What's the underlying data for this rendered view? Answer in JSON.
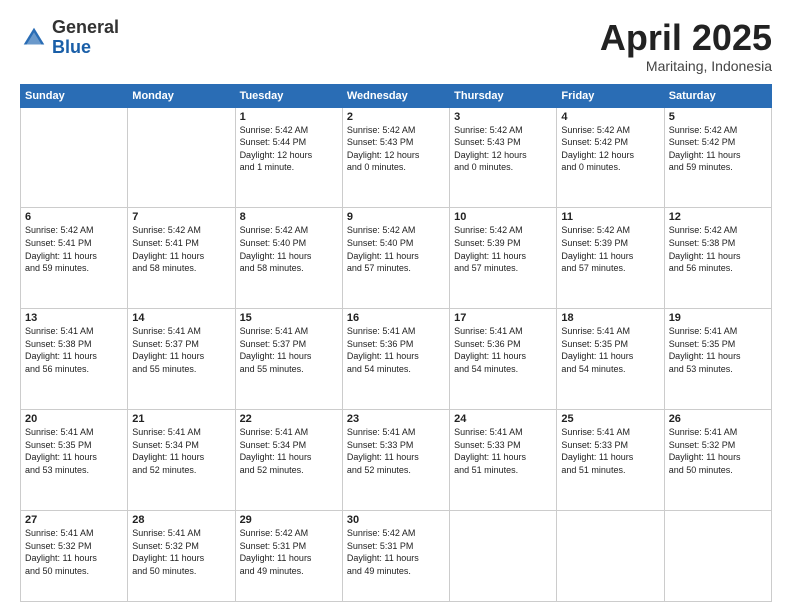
{
  "header": {
    "logo_general": "General",
    "logo_blue": "Blue",
    "month_title": "April 2025",
    "location": "Maritaing, Indonesia"
  },
  "weekdays": [
    "Sunday",
    "Monday",
    "Tuesday",
    "Wednesday",
    "Thursday",
    "Friday",
    "Saturday"
  ],
  "weeks": [
    [
      {
        "day": "",
        "info": ""
      },
      {
        "day": "",
        "info": ""
      },
      {
        "day": "1",
        "info": "Sunrise: 5:42 AM\nSunset: 5:44 PM\nDaylight: 12 hours\nand 1 minute."
      },
      {
        "day": "2",
        "info": "Sunrise: 5:42 AM\nSunset: 5:43 PM\nDaylight: 12 hours\nand 0 minutes."
      },
      {
        "day": "3",
        "info": "Sunrise: 5:42 AM\nSunset: 5:43 PM\nDaylight: 12 hours\nand 0 minutes."
      },
      {
        "day": "4",
        "info": "Sunrise: 5:42 AM\nSunset: 5:42 PM\nDaylight: 12 hours\nand 0 minutes."
      },
      {
        "day": "5",
        "info": "Sunrise: 5:42 AM\nSunset: 5:42 PM\nDaylight: 11 hours\nand 59 minutes."
      }
    ],
    [
      {
        "day": "6",
        "info": "Sunrise: 5:42 AM\nSunset: 5:41 PM\nDaylight: 11 hours\nand 59 minutes."
      },
      {
        "day": "7",
        "info": "Sunrise: 5:42 AM\nSunset: 5:41 PM\nDaylight: 11 hours\nand 58 minutes."
      },
      {
        "day": "8",
        "info": "Sunrise: 5:42 AM\nSunset: 5:40 PM\nDaylight: 11 hours\nand 58 minutes."
      },
      {
        "day": "9",
        "info": "Sunrise: 5:42 AM\nSunset: 5:40 PM\nDaylight: 11 hours\nand 57 minutes."
      },
      {
        "day": "10",
        "info": "Sunrise: 5:42 AM\nSunset: 5:39 PM\nDaylight: 11 hours\nand 57 minutes."
      },
      {
        "day": "11",
        "info": "Sunrise: 5:42 AM\nSunset: 5:39 PM\nDaylight: 11 hours\nand 57 minutes."
      },
      {
        "day": "12",
        "info": "Sunrise: 5:42 AM\nSunset: 5:38 PM\nDaylight: 11 hours\nand 56 minutes."
      }
    ],
    [
      {
        "day": "13",
        "info": "Sunrise: 5:41 AM\nSunset: 5:38 PM\nDaylight: 11 hours\nand 56 minutes."
      },
      {
        "day": "14",
        "info": "Sunrise: 5:41 AM\nSunset: 5:37 PM\nDaylight: 11 hours\nand 55 minutes."
      },
      {
        "day": "15",
        "info": "Sunrise: 5:41 AM\nSunset: 5:37 PM\nDaylight: 11 hours\nand 55 minutes."
      },
      {
        "day": "16",
        "info": "Sunrise: 5:41 AM\nSunset: 5:36 PM\nDaylight: 11 hours\nand 54 minutes."
      },
      {
        "day": "17",
        "info": "Sunrise: 5:41 AM\nSunset: 5:36 PM\nDaylight: 11 hours\nand 54 minutes."
      },
      {
        "day": "18",
        "info": "Sunrise: 5:41 AM\nSunset: 5:35 PM\nDaylight: 11 hours\nand 54 minutes."
      },
      {
        "day": "19",
        "info": "Sunrise: 5:41 AM\nSunset: 5:35 PM\nDaylight: 11 hours\nand 53 minutes."
      }
    ],
    [
      {
        "day": "20",
        "info": "Sunrise: 5:41 AM\nSunset: 5:35 PM\nDaylight: 11 hours\nand 53 minutes."
      },
      {
        "day": "21",
        "info": "Sunrise: 5:41 AM\nSunset: 5:34 PM\nDaylight: 11 hours\nand 52 minutes."
      },
      {
        "day": "22",
        "info": "Sunrise: 5:41 AM\nSunset: 5:34 PM\nDaylight: 11 hours\nand 52 minutes."
      },
      {
        "day": "23",
        "info": "Sunrise: 5:41 AM\nSunset: 5:33 PM\nDaylight: 11 hours\nand 52 minutes."
      },
      {
        "day": "24",
        "info": "Sunrise: 5:41 AM\nSunset: 5:33 PM\nDaylight: 11 hours\nand 51 minutes."
      },
      {
        "day": "25",
        "info": "Sunrise: 5:41 AM\nSunset: 5:33 PM\nDaylight: 11 hours\nand 51 minutes."
      },
      {
        "day": "26",
        "info": "Sunrise: 5:41 AM\nSunset: 5:32 PM\nDaylight: 11 hours\nand 50 minutes."
      }
    ],
    [
      {
        "day": "27",
        "info": "Sunrise: 5:41 AM\nSunset: 5:32 PM\nDaylight: 11 hours\nand 50 minutes."
      },
      {
        "day": "28",
        "info": "Sunrise: 5:41 AM\nSunset: 5:32 PM\nDaylight: 11 hours\nand 50 minutes."
      },
      {
        "day": "29",
        "info": "Sunrise: 5:42 AM\nSunset: 5:31 PM\nDaylight: 11 hours\nand 49 minutes."
      },
      {
        "day": "30",
        "info": "Sunrise: 5:42 AM\nSunset: 5:31 PM\nDaylight: 11 hours\nand 49 minutes."
      },
      {
        "day": "",
        "info": ""
      },
      {
        "day": "",
        "info": ""
      },
      {
        "day": "",
        "info": ""
      }
    ]
  ]
}
